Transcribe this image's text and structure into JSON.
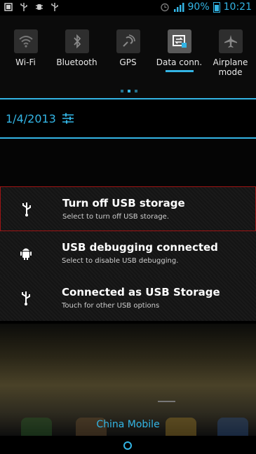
{
  "status_bar": {
    "battery": "90%",
    "time": "10:21",
    "left_icons": [
      "screenshot-icon",
      "usb-icon",
      "debug-icon",
      "usb-icon"
    ],
    "right_icons": [
      "alarm-icon",
      "signal-icon",
      "battery-icon"
    ]
  },
  "quick_settings": {
    "items": [
      {
        "label": "Wi-Fi",
        "icon": "wifi-icon"
      },
      {
        "label": "Bluetooth",
        "icon": "bluetooth-icon"
      },
      {
        "label": "GPS",
        "icon": "gps-icon"
      },
      {
        "label": "Data conn.",
        "icon": "data-connection-icon",
        "active": true
      },
      {
        "label": "Airplane mode",
        "icon": "airplane-icon"
      }
    ],
    "page_indicator": {
      "pages": 3,
      "current": 2
    }
  },
  "date": "1/4/2013",
  "notifications": [
    {
      "title": "Turn off USB storage",
      "subtitle": "Select to turn off USB storage.",
      "icon": "usb-icon"
    },
    {
      "title": "USB debugging connected",
      "subtitle": "Select to disable USB debugging.",
      "icon": "android-debug-icon"
    },
    {
      "title": "Connected as USB Storage",
      "subtitle": "Touch for other USB options",
      "icon": "usb-icon"
    }
  ],
  "carrier": "China Mobile",
  "colors": {
    "accent": "#33b5e5",
    "selection_border": "#a01515"
  }
}
